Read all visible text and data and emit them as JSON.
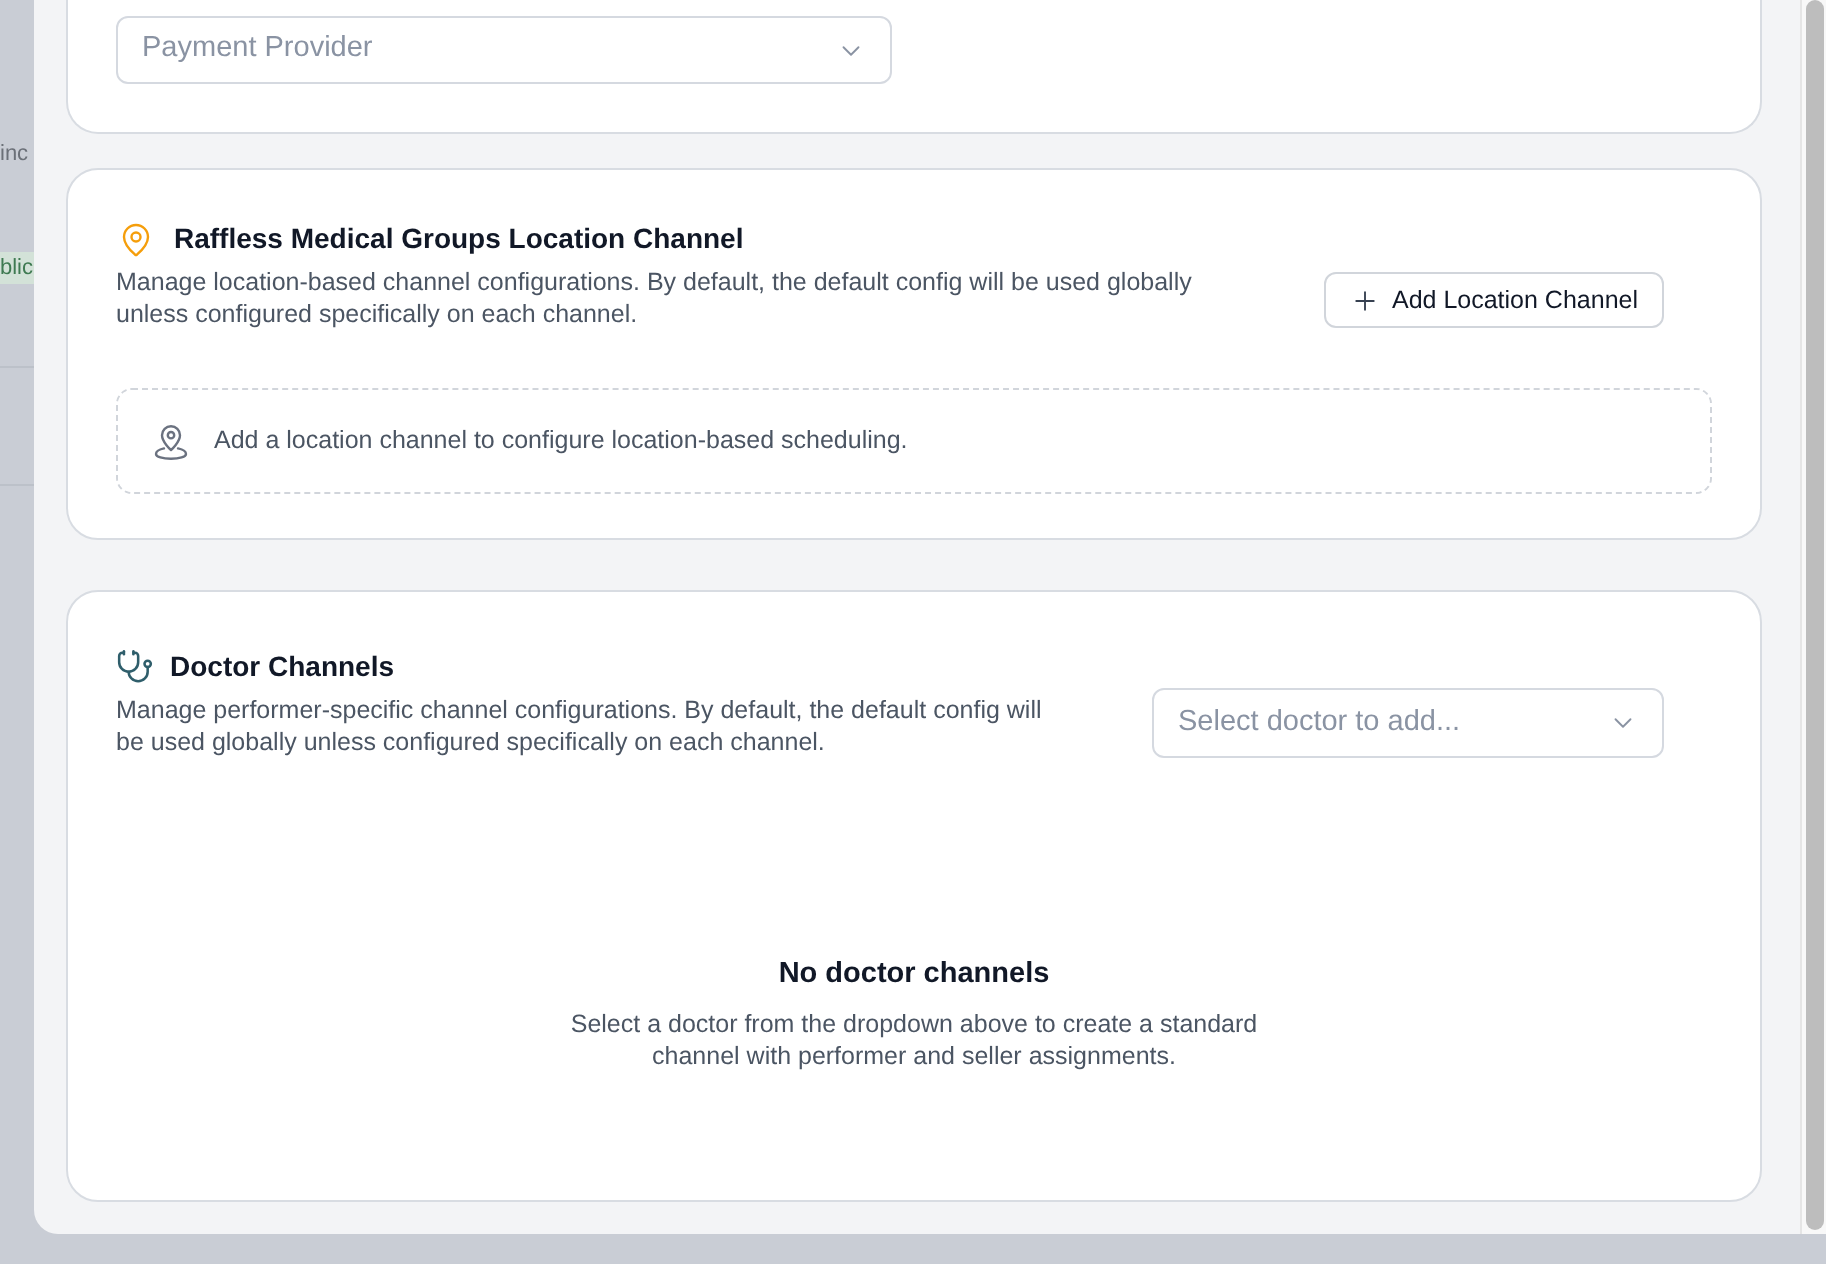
{
  "background_page": {
    "text": "inc",
    "badge": "blic"
  },
  "payment_card": {
    "select": {
      "placeholder": "Payment Provider"
    }
  },
  "location_card": {
    "title": "Raffless Medical Groups Location Channel",
    "description": "Manage location-based channel configurations. By default, the default config will be used globally unless configured specifically on each channel.",
    "add_button": "Add Location Channel",
    "empty_message": "Add a location channel to configure location-based scheduling."
  },
  "doctor_card": {
    "title": "Doctor Channels",
    "description": "Manage performer-specific channel configurations. By default, the default config will be used globally unless configured specifically on each channel.",
    "select": {
      "placeholder": "Select doctor to add..."
    },
    "empty_title": "No doctor channels",
    "empty_description": "Select a doctor from the dropdown above to create a standard channel with performer and seller assignments."
  }
}
